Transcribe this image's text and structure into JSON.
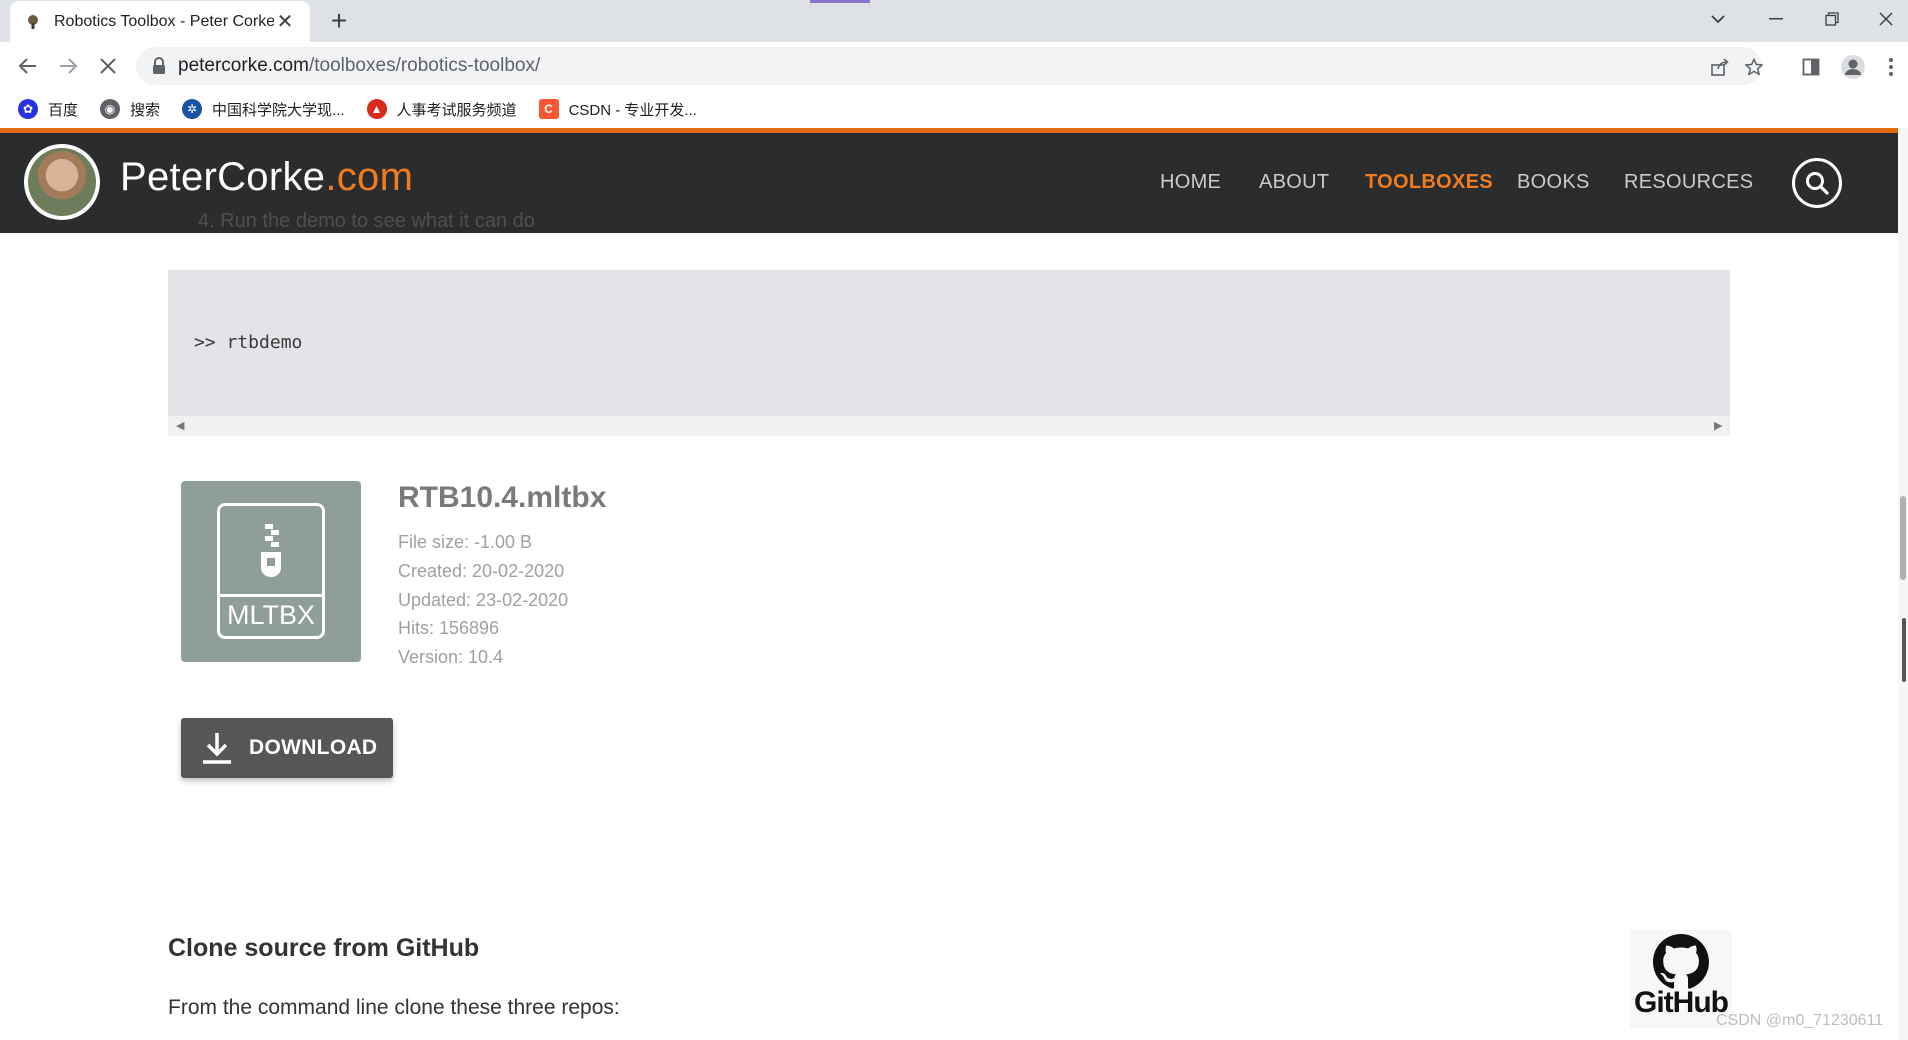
{
  "browser": {
    "tab_title": "Robotics Toolbox - Peter Corke",
    "url_host": "petercorke.com",
    "url_path": "/toolboxes/robotics-toolbox/",
    "bookmarks": [
      {
        "label": "百度",
        "color": "#2932e1",
        "glyph": "✿"
      },
      {
        "label": "搜索",
        "color": "#5f6368",
        "glyph": "◉"
      },
      {
        "label": "中国科学院大学现...",
        "color": "#1a52a8",
        "glyph": "✲"
      },
      {
        "label": "人事考试服务频道",
        "color": "#d9281c",
        "glyph": "▲"
      },
      {
        "label": "CSDN - 专业开发...",
        "color": "#fc5531",
        "glyph": "C"
      }
    ]
  },
  "site": {
    "logo_name": "PeterCorke",
    "logo_tld": ".com",
    "nav": {
      "home": "HOME",
      "about": "ABOUT",
      "toolboxes": "TOOLBOXES",
      "books": "BOOKS",
      "resources": "RESOURCES"
    },
    "ghost_step": "4. Run the demo to see what it can do"
  },
  "content": {
    "code": ">> rtbdemo",
    "file": {
      "name": "RTB10.4.mltbx",
      "icon_label": "MLTBX",
      "size": "File size: -1.00 B",
      "created": "Created: 20-02-2020",
      "updated": "Updated: 23-02-2020",
      "hits": "Hits: 156896",
      "version": "Version: 10.4"
    },
    "download_label": "DOWNLOAD",
    "clone_title": "Clone source from GitHub",
    "clone_text": "From the command line clone these three repos:",
    "github_label": "GitHub"
  },
  "watermark": "CSDN @m0_71230611"
}
